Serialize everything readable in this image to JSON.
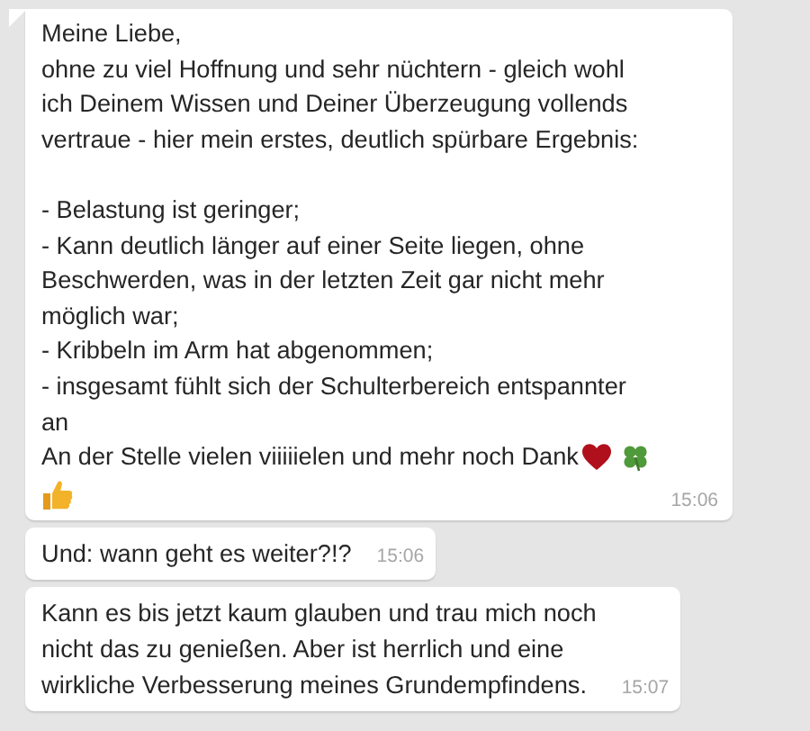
{
  "messages": [
    {
      "kind": "closing_emoji",
      "text": "Meine Liebe,\nohne zu viel Hoffnung und sehr nüchtern - gleich wohl\nich Deinem Wissen und Deiner Überzeugung vollends\nvertraue - hier mein erstes, deutlich spürbare Ergebnis:\n\n- Belastung ist geringer;\n- Kann deutlich länger auf einer Seite liegen, ohne\nBeschwerden, was in der letzten Zeit gar nicht mehr\nmöglich war;\n- Kribbeln im Arm hat abgenommen;\n- insgesamt fühlt sich der Schulterbereich entspannter\nan\n",
      "closing": "An der Stelle vielen viiiiielen und mehr noch Dank",
      "time": "15:06"
    },
    {
      "kind": "plain",
      "text": "Und: wann geht es weiter?!?",
      "time": "15:06"
    },
    {
      "kind": "plain",
      "text": "Kann es bis jetzt kaum glauben und trau mich noch\nnicht das zu genießen. Aber ist herrlich und eine\nwirkliche Verbesserung meines Grundempfindens.",
      "time": "15:07"
    }
  ]
}
